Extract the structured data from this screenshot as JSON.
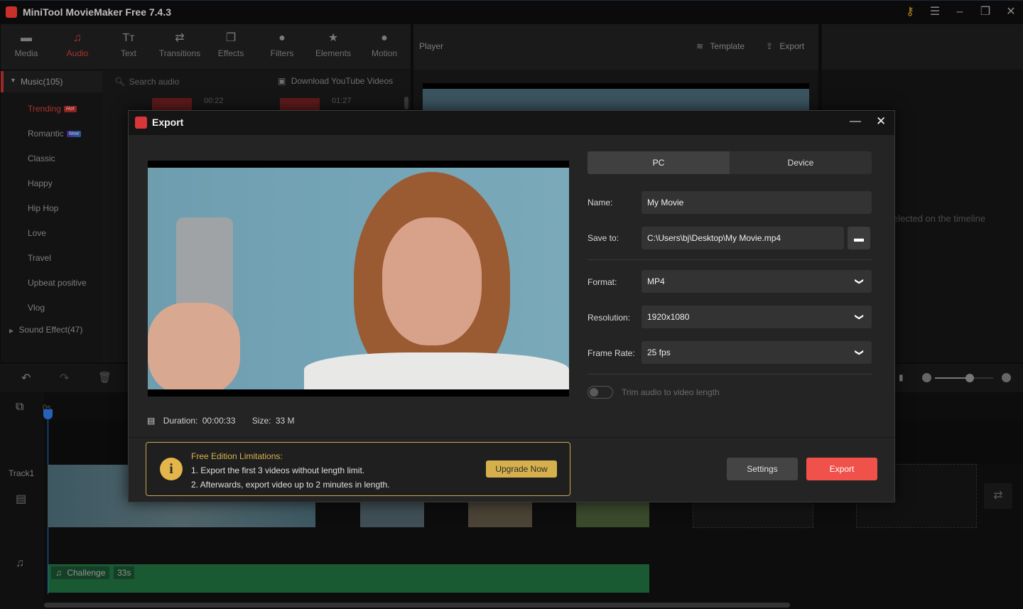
{
  "window": {
    "title": "MiniTool MovieMaker Free 7.4.3",
    "controls": [
      "key-icon",
      "menu-icon",
      "minimize-icon",
      "maximize-icon",
      "close-icon"
    ]
  },
  "library": {
    "tabs": [
      {
        "label": "Media",
        "icon": "folder-icon"
      },
      {
        "label": "Audio",
        "icon": "music-note-icon",
        "active": true
      },
      {
        "label": "Text",
        "icon": "text-icon"
      },
      {
        "label": "Transitions",
        "icon": "swap-arrows-icon"
      },
      {
        "label": "Effects",
        "icon": "effects-icon"
      },
      {
        "label": "Filters",
        "icon": "filters-icon"
      },
      {
        "label": "Elements",
        "icon": "elements-icon"
      },
      {
        "label": "Motion",
        "icon": "motion-icon"
      }
    ],
    "music_group": "Music(105)",
    "sound_effect_group": "Sound Effect(47)",
    "categories": [
      {
        "label": "Trending",
        "badge": "Hot",
        "active": true
      },
      {
        "label": "Romantic",
        "badge": "New"
      },
      {
        "label": "Classic"
      },
      {
        "label": "Happy"
      },
      {
        "label": "Hip Hop"
      },
      {
        "label": "Love"
      },
      {
        "label": "Travel"
      },
      {
        "label": "Upbeat positive"
      },
      {
        "label": "Vlog"
      }
    ],
    "search_placeholder": "Search audio",
    "download_link": "Download YouTube Videos",
    "track_times": [
      "00:22",
      "01:27"
    ]
  },
  "player": {
    "label": "Player",
    "template_label": "Template",
    "export_label": "Export"
  },
  "properties": {
    "hint": "elected on the timeline"
  },
  "timeline": {
    "playhead_label": "0s",
    "track_label": "Track1",
    "audio_clip": {
      "name": "Challenge",
      "duration": "33s"
    },
    "zoom_level": 0.6
  },
  "dialog": {
    "title": "Export",
    "tabs": {
      "pc": "PC",
      "device": "Device",
      "active": "PC"
    },
    "name_label": "Name:",
    "name_value": "My Movie",
    "save_label": "Save to:",
    "save_value": "C:\\Users\\bj\\Desktop\\My Movie.mp4",
    "format_label": "Format:",
    "format_value": "MP4",
    "resolution_label": "Resolution:",
    "resolution_value": "1920x1080",
    "framerate_label": "Frame Rate:",
    "framerate_value": "25 fps",
    "trim_label": "Trim audio to video length",
    "trim_on": false,
    "duration_label": "Duration:",
    "duration_value": "00:00:33",
    "size_label": "Size:",
    "size_value": "33 M",
    "limits_title": "Free Edition Limitations:",
    "limits_line1": "1. Export the first 3 videos without length limit.",
    "limits_line2": "2. Afterwards, export video up to 2 minutes in length.",
    "upgrade_label": "Upgrade Now",
    "settings_label": "Settings",
    "export_label": "Export"
  },
  "colors": {
    "accent_red": "#f0514a",
    "gold": "#d8b24f",
    "audio_clip": "#1f6b3c"
  }
}
